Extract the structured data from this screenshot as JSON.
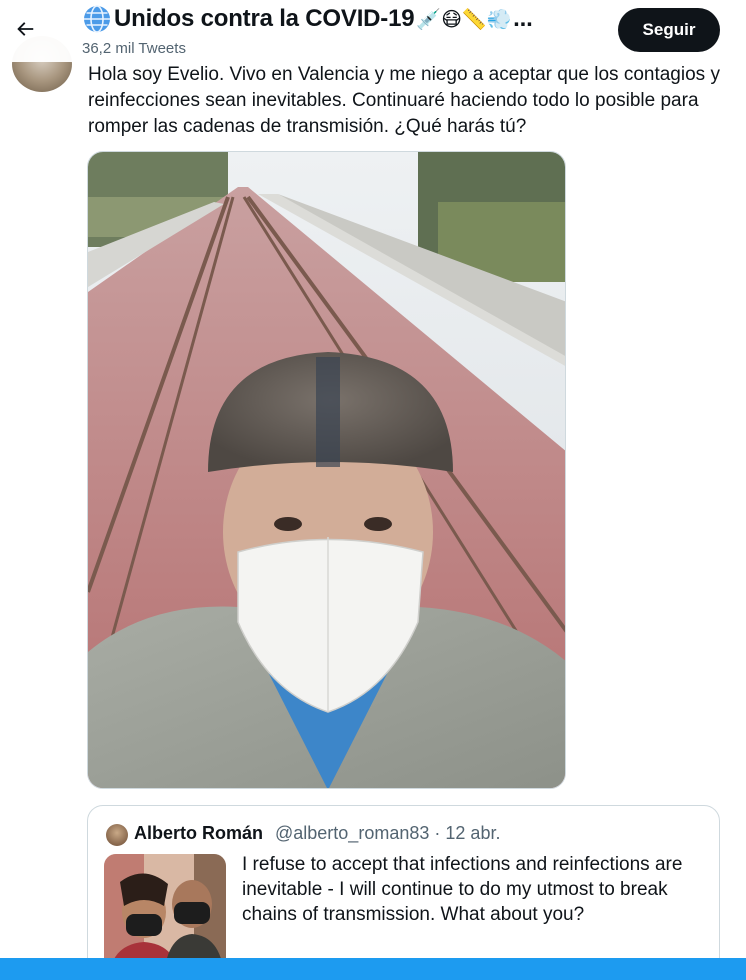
{
  "header": {
    "title": "Unidos contra la COVID-19",
    "title_emojis": "💉😷📏💨",
    "ellipsis": "...",
    "tweet_count": "36,2 mil Tweets",
    "follow_label": "Seguir",
    "back_icon": "arrow-left-icon"
  },
  "tweet": {
    "text": "Hola soy Evelio. Vivo en Valencia y me niego a aceptar que los contagios y reinfecciones sean inevitables. Continuaré haciendo todo lo posible para romper las cadenas de transmisión. ¿Qué harás tú?"
  },
  "quote": {
    "name": "Alberto Román",
    "handle": "@alberto_roman83",
    "date": "12 abr.",
    "separator": "·",
    "text": "I refuse to accept that infections and reinfections are inevitable - I will continue to do my utmost to break chains of transmission. What about you?"
  },
  "colors": {
    "accent": "#1d9bf0",
    "text": "#0f1419",
    "muted": "#536471",
    "follow_bg": "#0f1419"
  }
}
